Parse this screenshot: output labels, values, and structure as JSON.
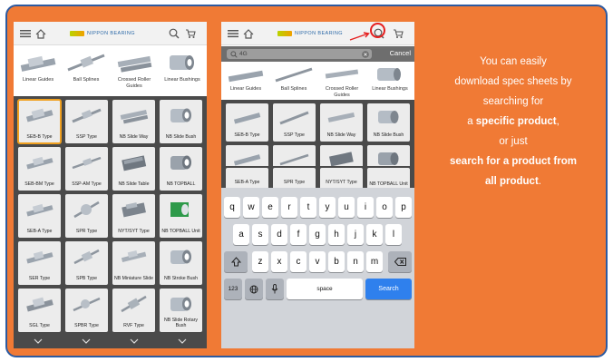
{
  "brand": "NIPPON BEARING",
  "categories": [
    {
      "label": "Linear Guides"
    },
    {
      "label": "Ball Splines"
    },
    {
      "label": "Crossed Roller Guides"
    },
    {
      "label": "Linear Bushings"
    }
  ],
  "products": [
    [
      "SEB-B Type",
      "SSP Type",
      "NB Slide Way",
      "NB Slide Bush"
    ],
    [
      "SEB-BM Type",
      "SSP-AM Type",
      "NB Slide Table",
      "NB TOPBALL"
    ],
    [
      "SEB-A Type",
      "SPR Type",
      "NYT/SYT Type",
      "NB TOPBALL Unit"
    ],
    [
      "SER Type",
      "SPB Type",
      "NB Miniature Slide",
      "NB Stroke Bush"
    ],
    [
      "SGL Type",
      "SPBR Type",
      "RVF Type",
      "NB Slide Rotary Bush"
    ]
  ],
  "selected_product": "SEB-B Type",
  "search": {
    "value": "4G",
    "cancel_label": "Cancel"
  },
  "keyboard": {
    "row1": [
      "q",
      "w",
      "e",
      "r",
      "t",
      "y",
      "u",
      "i",
      "o",
      "p"
    ],
    "row2": [
      "a",
      "s",
      "d",
      "f",
      "g",
      "h",
      "j",
      "k",
      "l"
    ],
    "row3": [
      "z",
      "x",
      "c",
      "v",
      "b",
      "n",
      "m"
    ],
    "numbers_label": "123",
    "space_label": "space",
    "search_label": "Search"
  },
  "caption": {
    "line1": "You can easily",
    "line2": "download spec sheets by",
    "line3": "searching for",
    "line4_pre": "a ",
    "line4_bold": "specific product",
    "line4_post": ",",
    "line5": "or just",
    "line6_bold": "search for a product from",
    "line7_bold": "all product",
    "line7_post": "."
  },
  "colors": {
    "background": "#f07a35",
    "border": "#2c5aa0",
    "highlight": "#e52020",
    "selection": "#f0a020",
    "search_key": "#2f80ed"
  }
}
